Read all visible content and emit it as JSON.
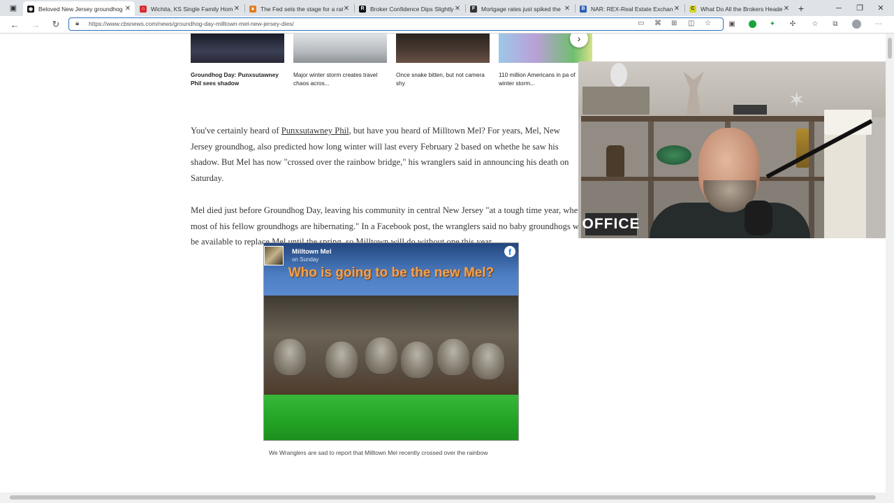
{
  "browser": {
    "tabs": [
      {
        "title": "Beloved New Jersey groundhog",
        "favicon": "cbs-eye-icon",
        "active": true
      },
      {
        "title": "Wichita, KS Single Family Home",
        "favicon": "home-icon",
        "active": false
      },
      {
        "title": "The Fed sets the stage for a rate",
        "favicon": "chart-icon",
        "active": false
      },
      {
        "title": "Broker Confidence Dips Slightly",
        "favicon": "r-icon",
        "active": false
      },
      {
        "title": "Mortgage rates just spiked the",
        "favicon": "f-icon",
        "active": false
      },
      {
        "title": "NAR: REX-Real Estate Exchange",
        "favicon": "b-icon",
        "active": false
      },
      {
        "title": "What Do All the Brokers Heade",
        "favicon": "c-icon",
        "active": false
      }
    ],
    "new_tab": "+",
    "url": "https://www.cbsnews.com/news/groundhog-day-milltown-mel-new-jersey-dies/"
  },
  "carousel": {
    "items": [
      {
        "caption": "Groundhog Day: Punxsutawney Phil sees shadow"
      },
      {
        "caption": "Major winter storm creates travel chaos acros..."
      },
      {
        "caption": "Once snake bitten, but not camera shy"
      },
      {
        "caption": "110 million Americans in pa of winter storm..."
      }
    ],
    "next_icon": "›"
  },
  "article": {
    "p1_before": "You've certainly heard of ",
    "p1_link": "Punxsutawney Phil",
    "p1_after": ", but have you heard of Milltown Mel? For years, Mel, New Jersey groundhog, also predicted how long winter will last every February 2 based on whethe he saw his shadow. But Mel has now \"crossed over the rainbow bridge,\" his wranglers said in announcing his death on Saturday.",
    "p2": "Mel died just before Groundhog Day, leaving his community in central New Jersey \"at a tough time year, when most of his fellow groundhogs are hibernating.\" In a Facebook post, the wranglers said no baby groundhogs will be available to replace Mel until the spring, so Milltown will do without one this year."
  },
  "facebook_post": {
    "page_name": "Milltown Mel",
    "time": "on Sunday",
    "headline": "Who is going to be the new Mel?",
    "caption": "We Wranglers are sad to report that Milltown Mel recently crossed over the rainbow"
  },
  "webcam": {
    "sign": "OFFICE"
  }
}
